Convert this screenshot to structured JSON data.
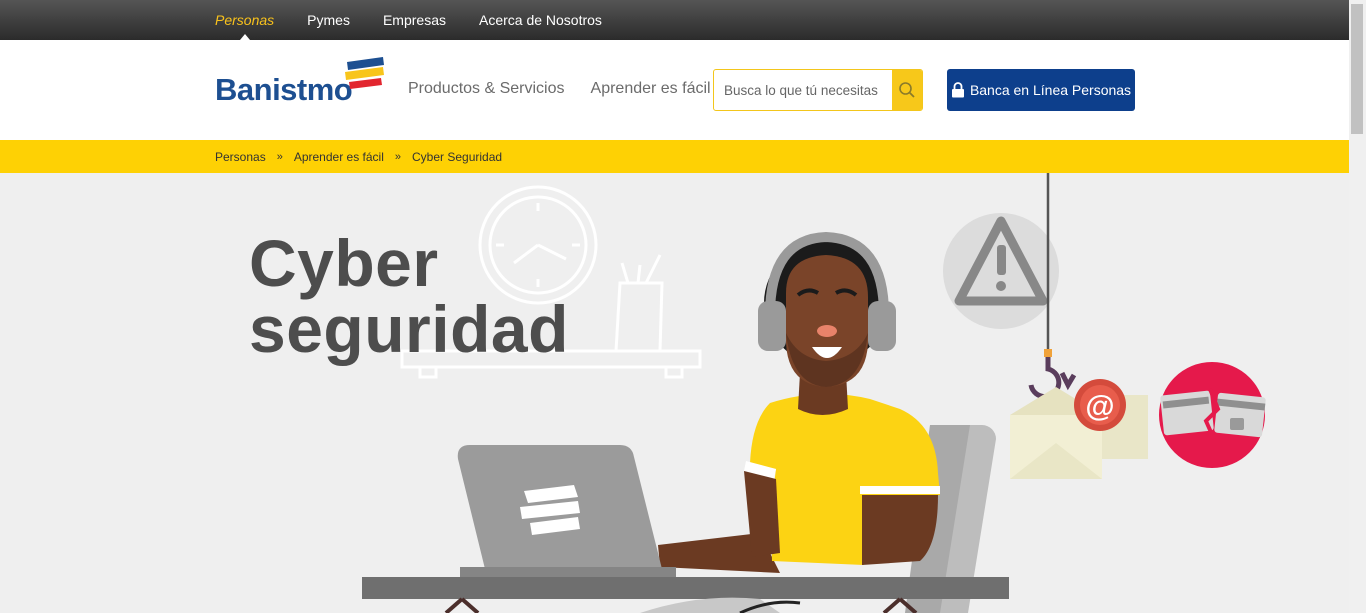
{
  "topnav": {
    "items": [
      {
        "label": "Personas",
        "active": true
      },
      {
        "label": "Pymes"
      },
      {
        "label": "Empresas"
      },
      {
        "label": "Acerca de Nosotros"
      }
    ]
  },
  "header": {
    "logo_text": "Banistmo",
    "nav": [
      {
        "label": "Productos & Servicios"
      },
      {
        "label": "Aprender es fácil"
      }
    ],
    "search": {
      "placeholder": "Busca lo que tú necesitas",
      "icon": "search-icon"
    },
    "banca_button": {
      "label": "Banca en Línea Personas",
      "icon": "lock-icon"
    }
  },
  "breadcrumb": {
    "items": [
      "Personas",
      "Aprender es fácil",
      "Cyber Seguridad"
    ],
    "separator": "»"
  },
  "hero": {
    "title_line1": "Cyber",
    "title_line2": "seguridad"
  },
  "colors": {
    "brand_blue": "#0d3f8c",
    "brand_yellow": "#fed104",
    "danger_red": "#e5194b"
  }
}
